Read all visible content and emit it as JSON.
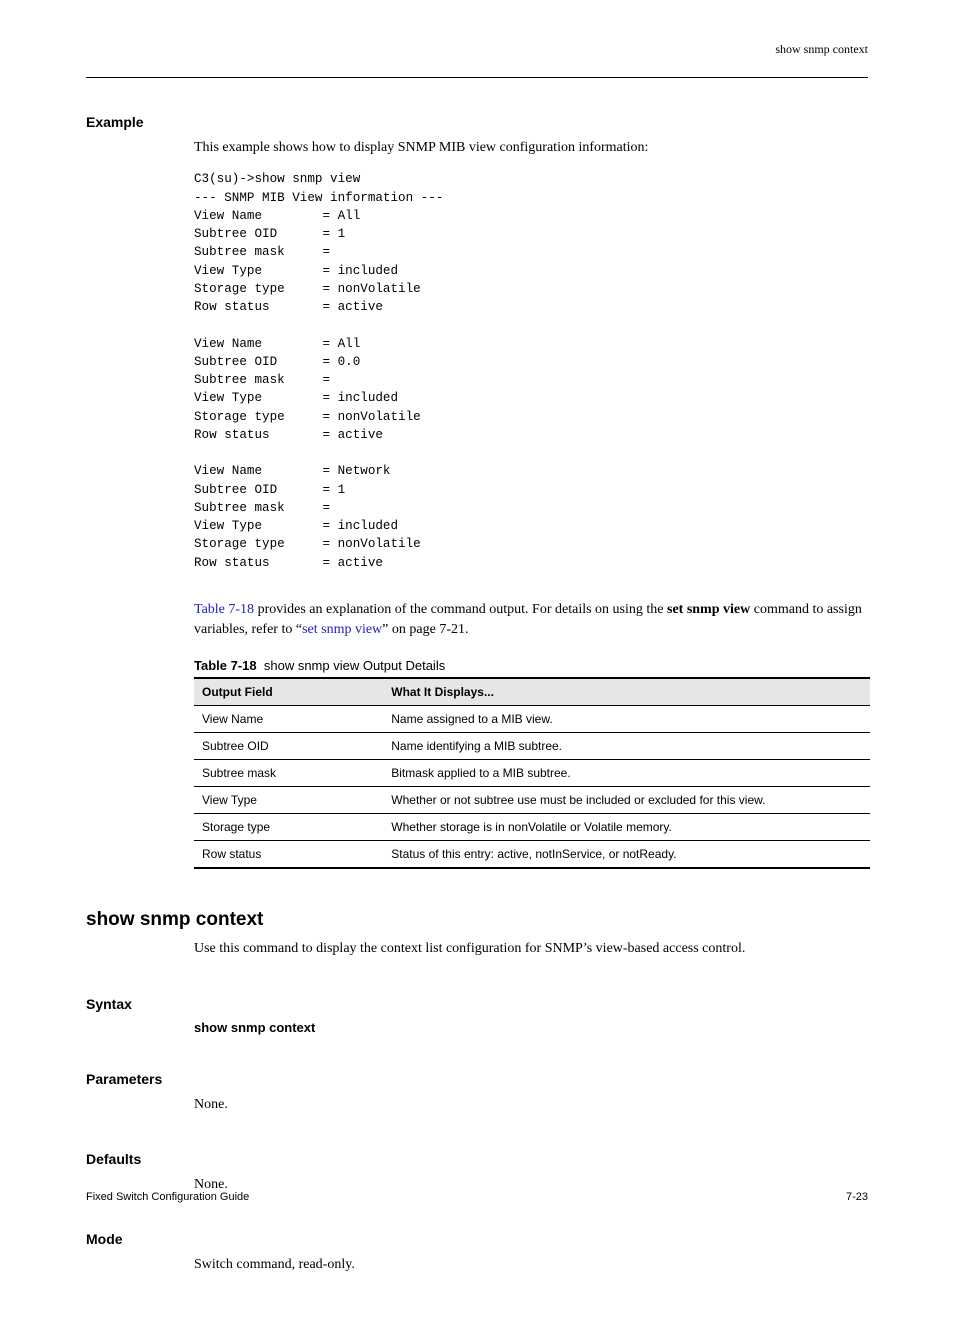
{
  "header": {
    "right_text": "show snmp context"
  },
  "example": {
    "heading": "Example",
    "intro": "This example shows how to display SNMP MIB view configuration information:",
    "code": "C3(su)->show snmp view\n--- SNMP MIB View information ---\nView Name        = All\nSubtree OID      = 1\nSubtree mask     =\nView Type        = included\nStorage type     = nonVolatile\nRow status       = active\n\nView Name        = All\nSubtree OID      = 0.0\nSubtree mask     =\nView Type        = included\nStorage type     = nonVolatile\nRow status       = active\n\nView Name        = Network\nSubtree OID      = 1\nSubtree mask     =\nView Type        = included\nStorage type     = nonVolatile\nRow status       = active",
    "after_code_pre": " provides an explanation of the command output. For details on using the ",
    "table_ref": "Table 7-18",
    "set_snmp_view_bold": "set snmp view",
    "command_word": " command to assign variables, refer to “",
    "link_text": "set snmp view",
    "on_page": "” on page 7-21."
  },
  "table": {
    "title_prefix": "Table 7-18",
    "title_rest": "show snmp view Output Details",
    "col_header_1": "Output Field",
    "col_header_2": "What It Displays...",
    "rows": [
      {
        "f": "View Name",
        "d": "Name assigned to a MIB view."
      },
      {
        "f": "Subtree OID",
        "d": "Name identifying a MIB subtree."
      },
      {
        "f": "Subtree mask",
        "d": "Bitmask applied to a MIB subtree."
      },
      {
        "f": "View Type",
        "d": "Whether or not subtree use must be included or excluded for this view."
      },
      {
        "f": "Storage type",
        "d": "Whether storage is in nonVolatile or Volatile memory."
      },
      {
        "f": "Row status",
        "d": "Status of this entry: active, notInService, or notReady."
      }
    ]
  },
  "cmd": {
    "heading": "show snmp context",
    "description": "Use this command to display the context list configuration for SNMP’s view-based access control.",
    "syntax_h": "Syntax",
    "syntax_code": "show snmp context",
    "parameters_h": "Parameters",
    "parameters_body": "None.",
    "defaults_h": "Defaults",
    "defaults_body": "None.",
    "mode_h": "Mode",
    "mode_body": "Switch command, read-only."
  },
  "footer": {
    "left": "Fixed Switch Configuration Guide",
    "right": "7-23"
  }
}
